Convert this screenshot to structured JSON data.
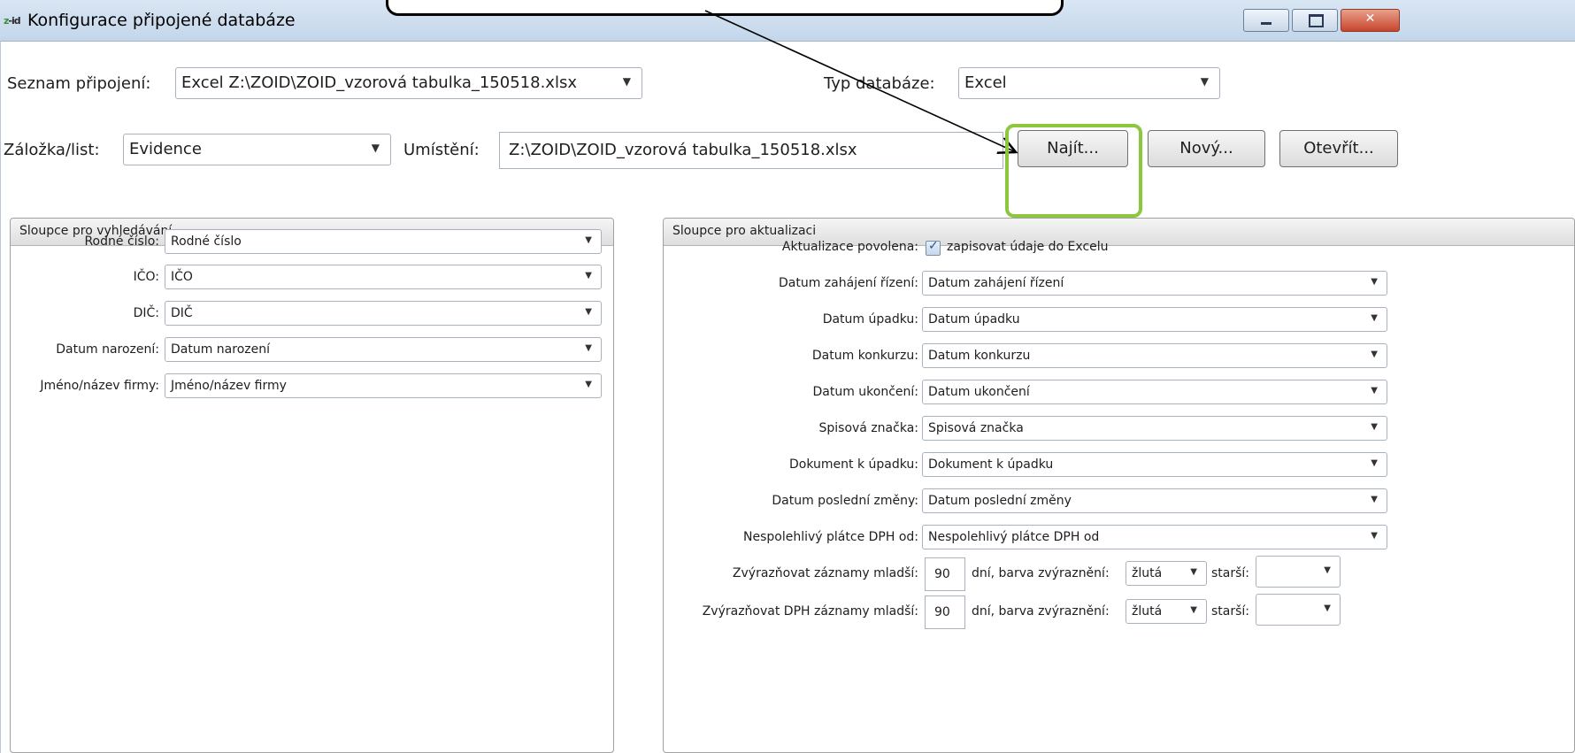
{
  "window": {
    "logo": "z-id",
    "title": "Konfigurace připojené databáze",
    "min_icon": "minimize-icon",
    "max_icon": "maximize-icon",
    "close_icon": "close-icon",
    "close_glyph": "✕"
  },
  "top": {
    "connections_label": "Seznam připojení:",
    "connections_value": "Excel Z:\\ZOID\\ZOID_vzorová tabulka_150518.xlsx",
    "dbtype_label": "Typ databáze:",
    "dbtype_value": "Excel",
    "sheet_label": "Záložka/list:",
    "sheet_value": "Evidence",
    "location_label": "Umístění:",
    "location_value": "Z:\\ZOID\\ZOID_vzorová tabulka_150518.xlsx",
    "find_button": "Najít...",
    "new_button": "Nový...",
    "open_button": "Otevřít..."
  },
  "search_panel": {
    "title": "Sloupce pro vyhledávání",
    "rows": [
      {
        "label": "Rodné číslo:",
        "value": "Rodné číslo"
      },
      {
        "label": "IČO:",
        "value": "IČO"
      },
      {
        "label": "DIČ:",
        "value": "DIČ"
      },
      {
        "label": "Datum narození:",
        "value": "Datum narození"
      },
      {
        "label": "Jméno/název firmy:",
        "value": "Jméno/název firmy"
      }
    ]
  },
  "update_panel": {
    "title": "Sloupce pro aktualizaci",
    "enabled_label": "Aktualizace povolena:",
    "enabled_checked": true,
    "enabled_text": "zapisovat údaje do Excelu",
    "rows": [
      {
        "label": "Datum zahájení řízení:",
        "value": "Datum zahájení řízení"
      },
      {
        "label": "Datum úpadku:",
        "value": "Datum úpadku"
      },
      {
        "label": "Datum konkurzu:",
        "value": "Datum konkurzu"
      },
      {
        "label": "Datum ukončení:",
        "value": "Datum ukončení"
      },
      {
        "label": "Spisová značka:",
        "value": "Spisová značka"
      },
      {
        "label": "Dokument k úpadku:",
        "value": "Dokument k úpadku"
      },
      {
        "label": "Datum poslední změny:",
        "value": "Datum poslední změny"
      },
      {
        "label": "Nespolehlivý plátce DPH od:",
        "value": "Nespolehlivý plátce DPH od"
      }
    ],
    "highlight_rows": [
      {
        "label": "Zvýrazňovat záznamy mladší:",
        "days": "90",
        "days_text": "dní, barva zvýraznění:",
        "color": "žlutá",
        "older_label": "starší:",
        "older_value": ""
      },
      {
        "label": "Zvýrazňovat DPH záznamy mladší:",
        "days": "90",
        "days_text": "dní, barva zvýraznění:",
        "color": "žlutá",
        "older_label": "starší:",
        "older_value": ""
      }
    ]
  },
  "icons": {
    "dropdown": "chevron-down-icon",
    "check": "checkmark-icon"
  },
  "colors": {
    "highlight_border": "#8dc63f",
    "titlebar": "#c9d9ec",
    "close_button": "#c8452c"
  }
}
